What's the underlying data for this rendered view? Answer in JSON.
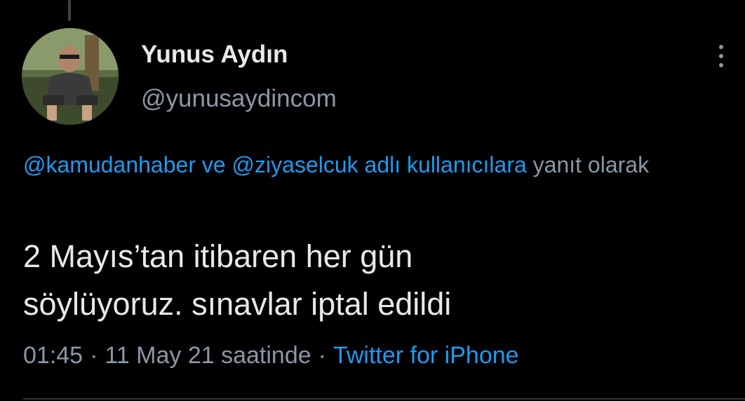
{
  "author": {
    "display_name": "Yunus Aydın",
    "handle": "@yunusaydincom"
  },
  "reply_context": {
    "mention_1": "@kamudanhaber",
    "connector": "ve",
    "mention_2": "@ziyaselcuk",
    "suffix_link": "adlı kullanıcılara",
    "suffix_text": "yanıt olarak"
  },
  "tweet": {
    "text_line_1": "2 Mayıs’tan itibaren her gün",
    "text_line_2": "söylüyoruz. sınavlar iptal edildi"
  },
  "meta": {
    "time": "01:45",
    "separator": "·",
    "date": "11 May 21 saatinde",
    "source": "Twitter for iPhone"
  },
  "colors": {
    "background": "#000000",
    "primary_text": "#e7e9ea",
    "secondary_text": "#8b98a5",
    "link": "#1d9bf0",
    "divider": "#2f3336"
  },
  "icons": {
    "more": "more-vertical-icon"
  }
}
